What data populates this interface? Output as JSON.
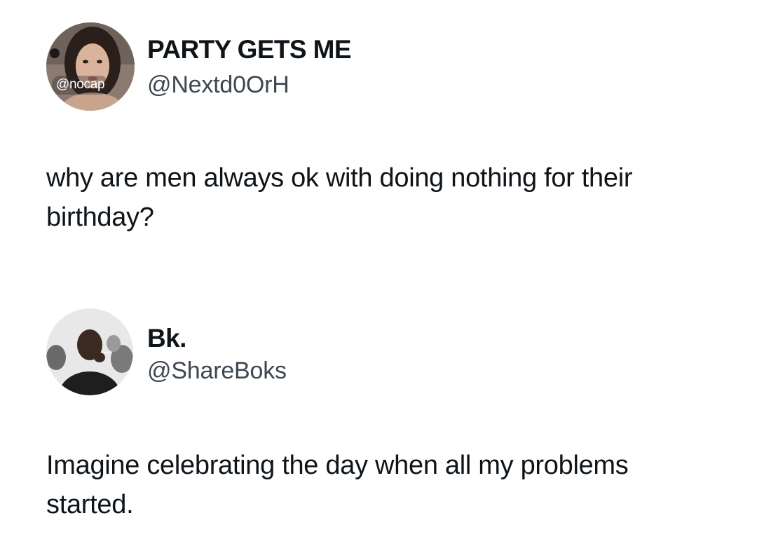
{
  "tweets": [
    {
      "display_name": "PARTY GETS ME",
      "handle": "@Nextd0OrH",
      "avatar_watermark": "@nocap",
      "avatar_icon": "profile-photo-woman",
      "text": "why are men always ok with doing nothing for their birthday?"
    },
    {
      "display_name": "Bk.",
      "handle": "@ShareBoks",
      "avatar_icon": "profile-photo-man",
      "text": "Imagine celebrating the day when all my problems started."
    }
  ],
  "colors": {
    "background": "#ffffff",
    "text_primary": "#0f1419",
    "text_secondary": "#3d4752"
  }
}
